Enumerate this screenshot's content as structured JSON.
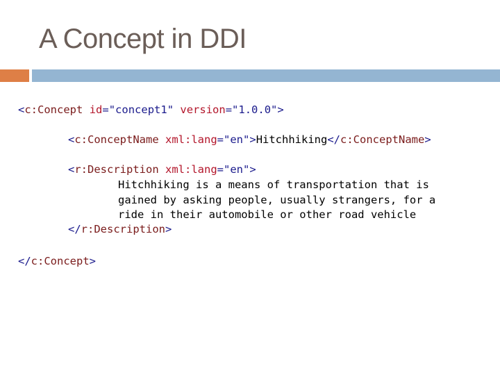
{
  "slide": {
    "title": "A Concept in DDI",
    "colors": {
      "accent_orange": "#de7f46",
      "accent_blue": "#94b5d2",
      "title": "#6b5e58"
    }
  },
  "code": {
    "concept_open": {
      "lt": "<",
      "tag": "c:Concept",
      "id_attr": "id",
      "eq1": "=",
      "id_val": "\"concept1\"",
      "ver_attr": "version",
      "eq2": "=",
      "ver_val": "\"1.0.0\"",
      "gt": ">"
    },
    "name_line": {
      "lt": "<",
      "tag": "c:ConceptName",
      "attr": "xml:lang",
      "eq": "=",
      "val": "\"en\"",
      "gt": ">",
      "text": "Hitchhiking",
      "close_lt": "</",
      "close_tag": "c:ConceptName",
      "close_gt": ">"
    },
    "desc_open": {
      "lt": "<",
      "tag": "r:Description",
      "attr": "xml:lang",
      "eq": "=",
      "val": "\"en\"",
      "gt": ">"
    },
    "desc_text": [
      "Hitchhiking is a means of transportation that is",
      "gained by asking people, usually strangers, for a",
      "ride in their automobile or other road vehicle"
    ],
    "desc_close": {
      "lt": "</",
      "tag": "r:Description",
      "gt": ">"
    },
    "concept_close": {
      "lt": "</",
      "tag": "c:Concept",
      "gt": ">"
    }
  }
}
